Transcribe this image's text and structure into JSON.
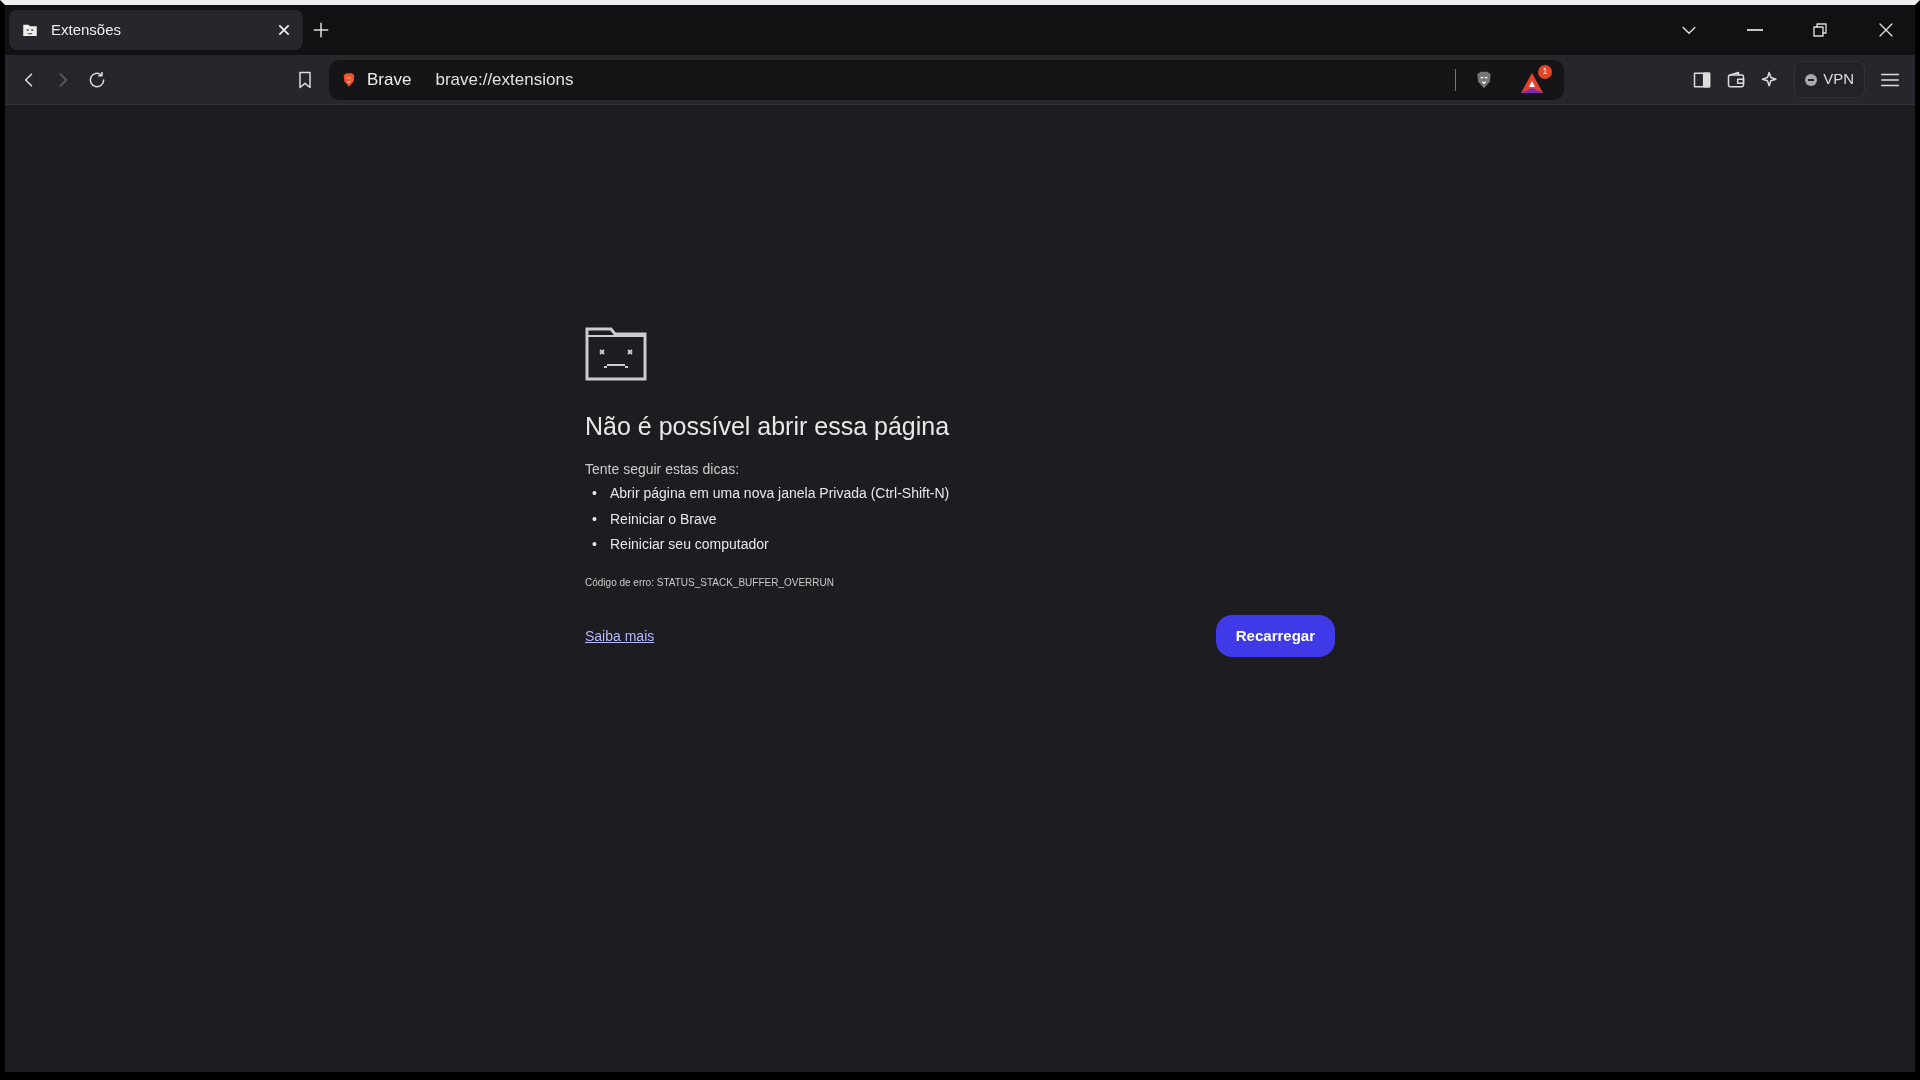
{
  "tabs": [
    {
      "title": "Extensões",
      "selected": true
    }
  ],
  "toolbar": {
    "back_disabled": false,
    "forward_disabled": true,
    "site_label": "Brave",
    "url": "brave://extensions",
    "rewards_badge": "1",
    "vpn_label": "VPN"
  },
  "error_page": {
    "title": "Não é possível abrir essa página",
    "tips_heading": "Tente seguir estas dicas:",
    "tip_marker": "•",
    "tips": [
      "Abrir página em uma nova janela Privada (Ctrl-Shift-N)",
      "Reiniciar o Brave",
      "Reiniciar seu computador"
    ],
    "error_code": "Código de erro: STATUS_STACK_BUFFER_OVERRUN",
    "learn_more": "Saiba mais",
    "reload_button": "Recarregar"
  }
}
